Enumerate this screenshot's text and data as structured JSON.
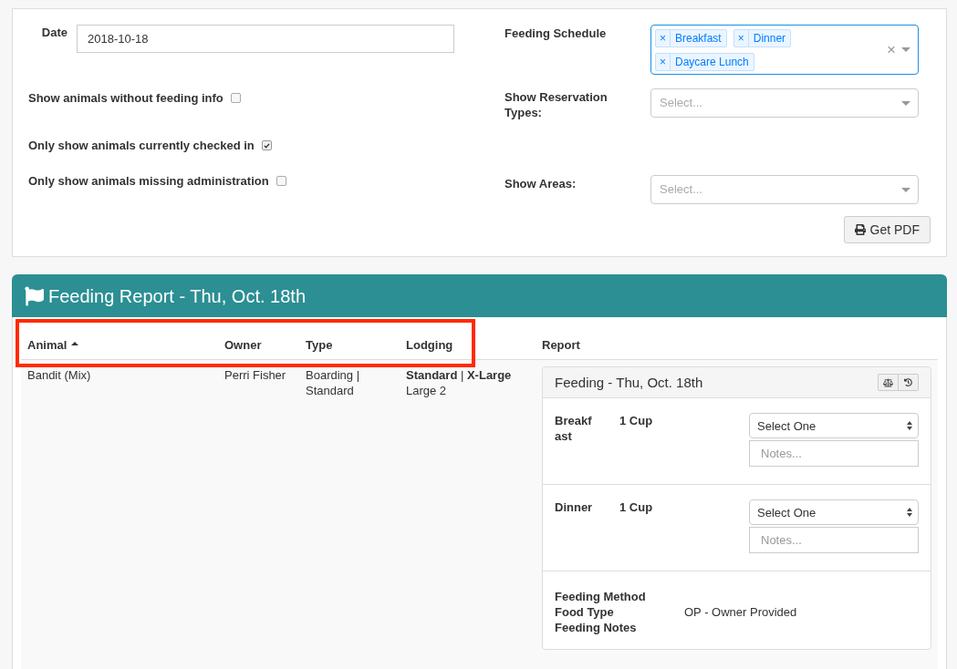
{
  "filters": {
    "date": {
      "label": "Date",
      "value": "2018-10-18"
    },
    "checkboxes": [
      {
        "label": "Show animals without feeding info",
        "checked": false
      },
      {
        "label": "Only show animals currently checked in",
        "checked": true
      },
      {
        "label": "Only show animals missing administration",
        "checked": false
      }
    ],
    "feeding_schedule": {
      "label": "Feeding Schedule",
      "tags": [
        {
          "remove": "×",
          "label": "Breakfast"
        },
        {
          "remove": "×",
          "label": "Dinner"
        },
        {
          "remove": "×",
          "label": "Daycare Lunch"
        }
      ],
      "clear": "×"
    },
    "reservation_types": {
      "label": "Show Reservation Types:",
      "placeholder": "Select..."
    },
    "areas": {
      "label": "Show Areas:",
      "placeholder": "Select..."
    },
    "pdf_button": {
      "label": "Get PDF"
    }
  },
  "report": {
    "title": "Feeding Report - Thu, Oct. 18th",
    "header_highlighted": true,
    "columns": [
      {
        "label": "Animal",
        "sorted": true
      },
      {
        "label": "Owner",
        "sorted": false
      },
      {
        "label": "Type",
        "sorted": false
      },
      {
        "label": "Lodging",
        "sorted": false
      },
      {
        "label": "Report",
        "sorted": false
      }
    ],
    "rows": [
      {
        "animal": "Bandit (Mix)",
        "owner": "Perri Fisher",
        "type": "Boarding | Standard",
        "lodging": "**Standard** | **X-Large**",
        "lodging_unit": "Large 2",
        "feeding": {
          "title": "Feeding - Thu, Oct. 18th",
          "meals": [
            {
              "name": "Breakfast",
              "amount": "1 Cup",
              "status": "Select One",
              "notes_placeholder": "Notes..."
            },
            {
              "name": "Dinner",
              "amount": "1 Cup",
              "status": "Select One",
              "notes_placeholder": "Notes..."
            }
          ],
          "info": [
            {
              "label": "Feeding Method"
            },
            {
              "label": "Food Type",
              "value": "OP - Owner Provided"
            },
            {
              "label": "Feeding Notes"
            }
          ]
        }
      }
    ]
  }
}
